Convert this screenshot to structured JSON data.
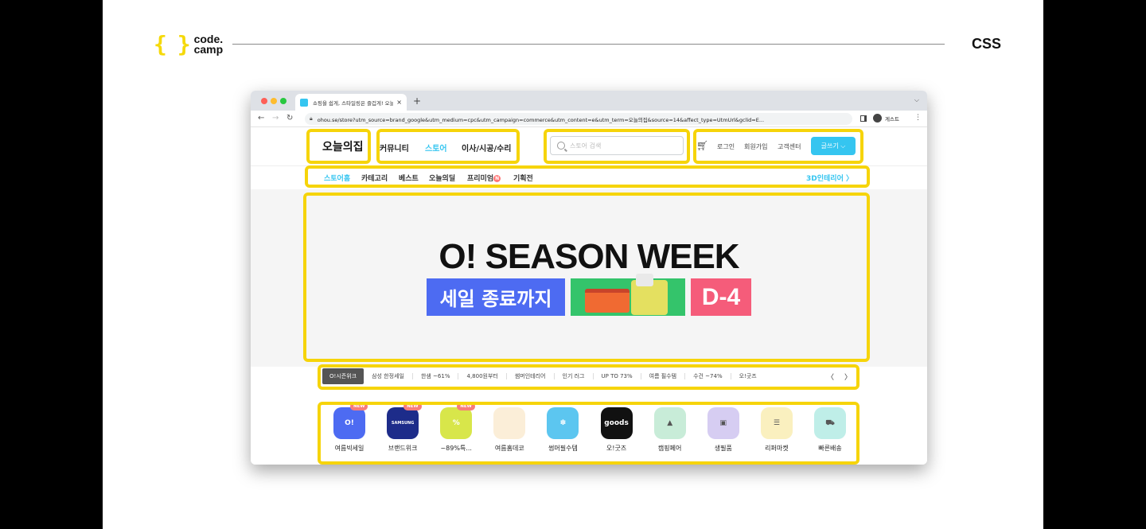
{
  "slide": {
    "logo_brace": "{ }",
    "logo_line1": "code.",
    "logo_line2": "camp",
    "tag": "CSS"
  },
  "browser": {
    "tab_title": "쇼핑을 쉽게, 스타일링은 즐겁게! 오늘",
    "tab_close": "×",
    "new_tab": "+",
    "url": "ohou.se/store?utm_source=brand_google&utm_medium=cpc&utm_campaign=commerce&utm_content=e&utm_term=오늘의집&source=14&affect_type=UtmUrl&gclid=E...",
    "profile_name": "게스트"
  },
  "header": {
    "logo": "오늘의집",
    "nav": [
      "커뮤니티",
      "스토어",
      "이사/시공/수리"
    ],
    "search_placeholder": "스토어 검색",
    "login": "로그인",
    "signup": "회원가입",
    "support": "고객센터",
    "write_button": "글쓰기 ⌵"
  },
  "subnav": {
    "items": [
      "스토어홈",
      "카테고리",
      "베스트",
      "오늘의딜",
      "프리미엄",
      "기획전"
    ],
    "premium_badge": "N",
    "right_link": "3D인테리어 〉"
  },
  "banner": {
    "title": "O! SEASON WEEK",
    "sale_text": "세일 종료까지",
    "dday": "D-4"
  },
  "chips": {
    "active": "O!시즌위크",
    "items": [
      "삼성 한정세일",
      "한샘 ~61%",
      "4,800원부터",
      "썸머인테리어",
      "인기 러그",
      "UP TO 73%",
      "여름 필수템",
      "수건 ~74%",
      "오!굿즈"
    ]
  },
  "categories": [
    {
      "label": "여름빅세일",
      "icon_text": "O!",
      "color": "#4d6bf2",
      "new": "NEW"
    },
    {
      "label": "브랜드위크",
      "icon_text": "SAMSUNG",
      "color": "#1d2c8a",
      "new": "NEW"
    },
    {
      "label": "~89%특...",
      "icon_text": "%",
      "color": "#d8e64a",
      "new": "NEW"
    },
    {
      "label": "여름홈데코",
      "icon_text": "",
      "color": "#fbeed8",
      "new": ""
    },
    {
      "label": "썸머필수템",
      "icon_text": "✽",
      "color": "#5cc6f0",
      "new": ""
    },
    {
      "label": "오!굿즈",
      "icon_text": "goods",
      "color": "#111111",
      "new": ""
    },
    {
      "label": "캠핑페어",
      "icon_text": "▲",
      "color": "#c8ecd8",
      "new": ""
    },
    {
      "label": "생필품",
      "icon_text": "▣",
      "color": "#d6cdf2",
      "new": ""
    },
    {
      "label": "리퍼마켓",
      "icon_text": "☰",
      "color": "#faf0bf",
      "new": ""
    },
    {
      "label": "빠른배송",
      "icon_text": "⛟",
      "color": "#bfeee8",
      "new": ""
    }
  ],
  "colors": {
    "highlight": "#f6d40a",
    "accent": "#35c5f0"
  }
}
